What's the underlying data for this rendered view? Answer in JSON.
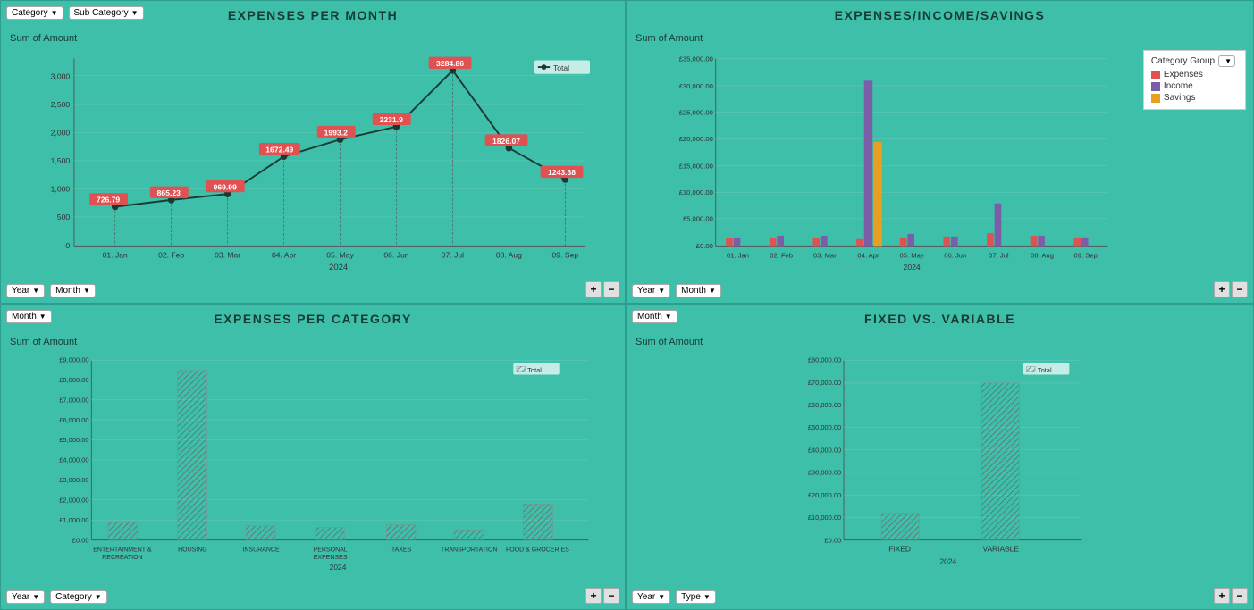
{
  "panels": {
    "top_left": {
      "title": "EXPENSES PER MONTH",
      "sum_label": "Sum of Amount",
      "filters_top": [
        "Category",
        "Sub Category"
      ],
      "filters_bottom": [
        "Year",
        "Month"
      ],
      "data_points": [
        {
          "label": "01. Jan",
          "value": 726.79,
          "x_pct": 0.055
        },
        {
          "label": "02. Feb",
          "value": 865.23,
          "x_pct": 0.165
        },
        {
          "label": "03. Mar",
          "value": 969.99,
          "x_pct": 0.275
        },
        {
          "label": "04. Apr",
          "value": 1672.49,
          "x_pct": 0.385
        },
        {
          "label": "05. May",
          "value": 1993.2,
          "x_pct": 0.495
        },
        {
          "label": "06. Jun",
          "value": 2231.9,
          "x_pct": 0.605
        },
        {
          "label": "07. Jul",
          "value": 3284.86,
          "x_pct": 0.715
        },
        {
          "label": "08. Aug",
          "value": 1826.07,
          "x_pct": 0.825
        },
        {
          "label": "09. Sep",
          "value": 1243.38,
          "x_pct": 0.935
        }
      ],
      "year_label": "2024",
      "legend_label": "Total"
    },
    "top_right": {
      "title": "EXPENSES/INCOME/SAVINGS",
      "sum_label": "Sum of Amount",
      "filters_bottom": [
        "Year",
        "Month"
      ],
      "legend_filter": "Category Group",
      "legend_items": [
        {
          "label": "Expenses",
          "color": "#e05252"
        },
        {
          "label": "Income",
          "color": "#7b5ea7"
        },
        {
          "label": "Savings",
          "color": "#e8a020"
        }
      ],
      "x_labels": [
        "01. Jan",
        "02. Feb",
        "03. Mar",
        "04. Apr",
        "05. May",
        "06. Jun",
        "07. Jul",
        "08. Aug",
        "09. Sep"
      ],
      "year_label": "2024",
      "y_labels": [
        "£0.00",
        "£5,000.00",
        "£10,000.00",
        "£15,000.00",
        "£20,000.00",
        "£25,000.00",
        "£30,000.00",
        "£35,000.00"
      ]
    },
    "bottom_left": {
      "title": "EXPENSES PER CATEGORY",
      "sum_label": "Sum of Amount",
      "filters_top": [
        "Month"
      ],
      "filters_bottom": [
        "Year",
        "Category"
      ],
      "categories": [
        {
          "label": "ENTERTAINMENT &\nRECREATION",
          "value": 900
        },
        {
          "label": "HOUSING",
          "value": 8500
        },
        {
          "label": "INSURANCE",
          "value": 700
        },
        {
          "label": "PERSONAL\nEXPENSES",
          "value": 650
        },
        {
          "label": "TAXES",
          "value": 750
        },
        {
          "label": "TRANSPORTATION",
          "value": 500
        },
        {
          "label": "FOOD & GROCERIES",
          "value": 1800
        }
      ],
      "y_labels": [
        "£0.00",
        "£1,000.00",
        "£2,000.00",
        "£3,000.00",
        "£4,000.00",
        "£5,000.00",
        "£6,000.00",
        "£7,000.00",
        "£8,000.00",
        "£9,000.00"
      ],
      "year_label": "2024",
      "legend_label": "Total"
    },
    "bottom_right": {
      "title": "FIXED VS. VARIABLE",
      "sum_label": "Sum of Amount",
      "filters_top": [
        "Month"
      ],
      "filters_bottom": [
        "Year",
        "Type"
      ],
      "categories": [
        {
          "label": "FIXED",
          "value": 12000
        },
        {
          "label": "VARIABLE",
          "value": 70000
        }
      ],
      "y_labels": [
        "£0.00",
        "£10,000.00",
        "£20,000.00",
        "£30,000.00",
        "£40,000.00",
        "£50,000.00",
        "£60,000.00",
        "£70,000.00",
        "£80,000.00"
      ],
      "year_label": "2024",
      "legend_label": "Total"
    }
  }
}
